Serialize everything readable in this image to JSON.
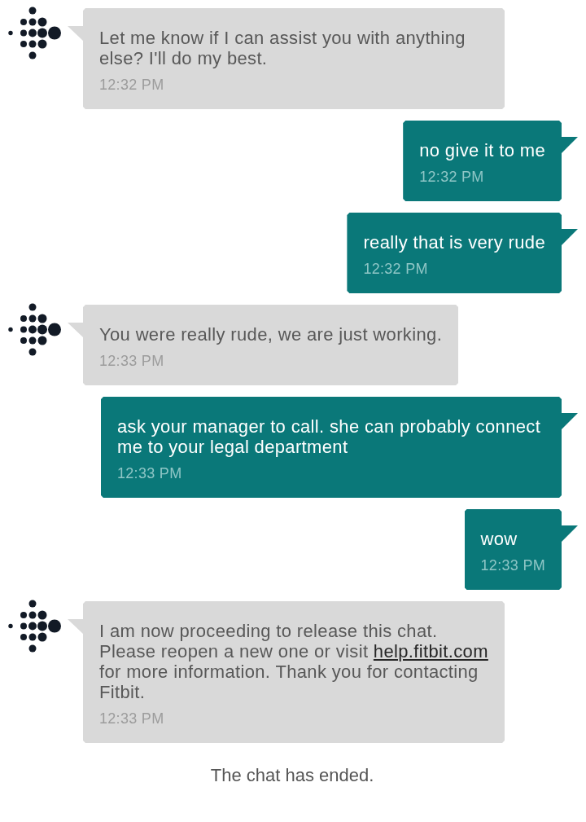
{
  "messages": [
    {
      "kind": "agent",
      "text": "Let me know if I can assist you with anything else? I'll do my best.",
      "time": "12:32 PM"
    },
    {
      "kind": "user",
      "text": "no give it to me",
      "time": "12:32 PM"
    },
    {
      "kind": "user",
      "text": "really that is very rude",
      "time": "12:32 PM"
    },
    {
      "kind": "agent",
      "text": "You were really rude, we are just working.",
      "time": "12:33 PM"
    },
    {
      "kind": "user",
      "text": "ask your manager to call. she can probably connect me to your legal department",
      "time": "12:33 PM"
    },
    {
      "kind": "user",
      "text": "wow",
      "time": "12:33 PM"
    },
    {
      "kind": "agent",
      "parts": [
        {
          "kind": "text",
          "text": "I am now proceeding to release this chat. Please reopen a new one or visit "
        },
        {
          "kind": "link",
          "text": "help.fitbit.com"
        },
        {
          "kind": "text",
          "text": " for more information. Thank you for contacting Fitbit."
        }
      ],
      "time": "12:33 PM"
    }
  ],
  "status": "The chat has ended."
}
